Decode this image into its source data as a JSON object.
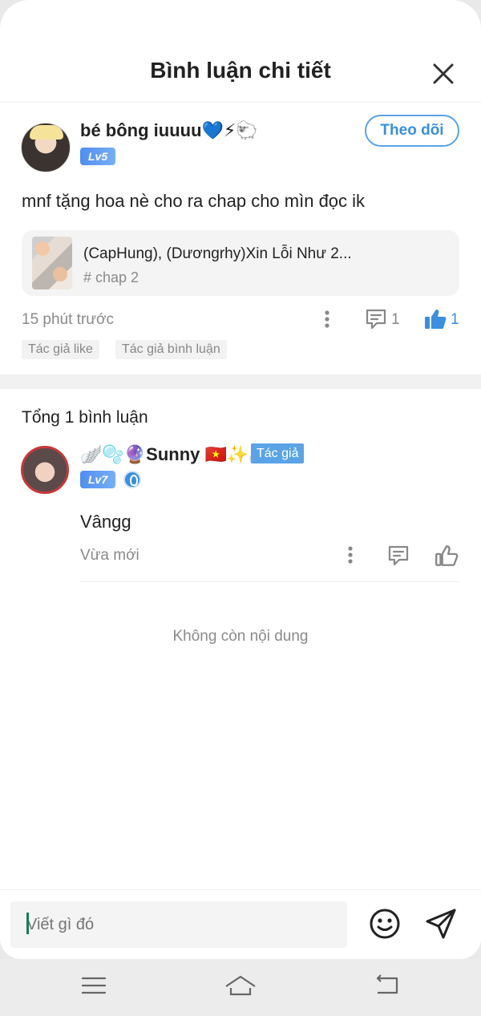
{
  "header": {
    "title": "Bình luận chi tiết"
  },
  "post": {
    "username": "bé bông iuuuu💙⚡🐑",
    "level": "Lv5",
    "follow_label": "Theo dõi",
    "text": "mnf tặng hoa nè cho ra chap cho mìn đọc ik",
    "chapter": {
      "title": "(CapHung), (Dươngrhy)Xin Lỗi Như 2...",
      "sub": "# chap 2"
    },
    "time": "15 phút trước",
    "comment_count": "1",
    "like_count": "1",
    "tags": [
      "Tác giả like",
      "Tác giả bình luận"
    ]
  },
  "total_label": "Tổng 1 bình luận",
  "reply": {
    "username": "🪽🫧🔮Sunny 🇻🇳✨🪽",
    "author_badge": "Tác giả",
    "level": "Lv7",
    "text": "Vângg",
    "time": "Vừa mới"
  },
  "no_more": "Không còn nội dung",
  "composer": {
    "placeholder": "Viết gì đó"
  },
  "colors": {
    "accent": "#3a8fe0",
    "badge_blue": "#5aa3e6",
    "muted": "#8a8a8a"
  },
  "icons": [
    "close-icon",
    "more-icon",
    "comment-icon",
    "like-icon",
    "emoji-icon",
    "send-icon",
    "menu-icon",
    "home-icon",
    "back-icon"
  ]
}
